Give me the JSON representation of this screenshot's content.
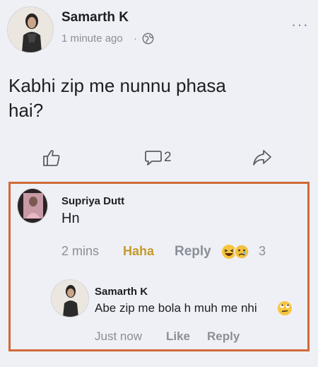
{
  "post": {
    "author": "Samarth K",
    "time": "1 minute ago",
    "separator": "·",
    "text_line1": "Kabhi zip me nunnu phasa",
    "text_line2": "hai?",
    "comment_count": "2",
    "menu": "···"
  },
  "comments": [
    {
      "author": "Supriya Dutt",
      "text": "Hn",
      "time": "2 mins",
      "reaction_label": "Haha",
      "reply_label": "Reply",
      "reaction_count": "3"
    }
  ],
  "reply": {
    "author": "Samarth K",
    "text": "Abe zip me bola h muh me nhi",
    "time": "Just now",
    "like_label": "Like",
    "reply_label": "Reply"
  },
  "icons": {
    "privacy": "friends-icon",
    "like": "thumbs-up-icon",
    "comment": "comment-bubble-icon",
    "share": "share-arrow-icon",
    "reactions": [
      "haha-emoji-icon",
      "sad-emoji-icon"
    ],
    "inline_emoji": "rolling-eyes-emoji-icon"
  },
  "colors": {
    "highlight_border": "#d06a35",
    "haha": "#c49a2a",
    "muted": "#8b8e96"
  }
}
